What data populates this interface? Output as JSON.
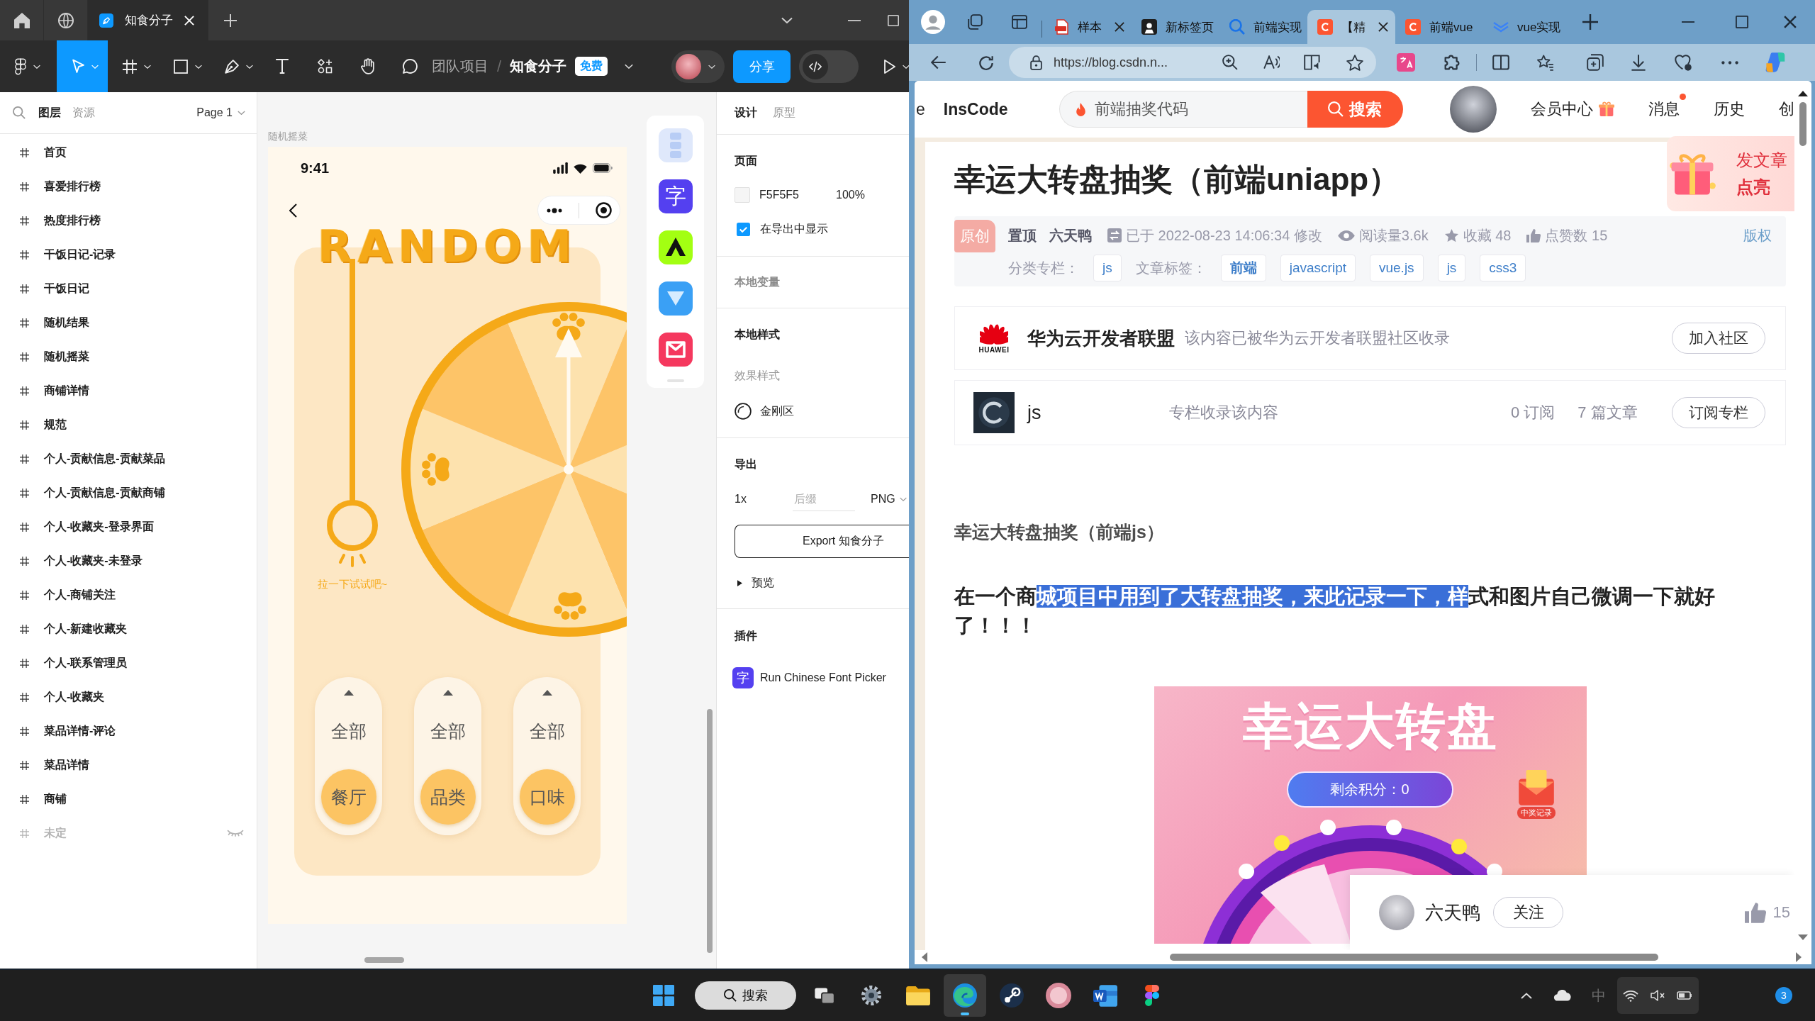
{
  "figma": {
    "tabs": [
      {
        "kind": "home",
        "selected": false
      },
      {
        "kind": "globe",
        "selected": false
      },
      {
        "kind": "file",
        "label": "知食分子",
        "selected": true
      }
    ],
    "tools": [
      {
        "kind": "main-menu",
        "selected": false
      },
      {
        "kind": "move",
        "selected": true
      },
      {
        "kind": "frame",
        "selected": false
      },
      {
        "kind": "shape",
        "selected": false
      },
      {
        "kind": "pen",
        "selected": false
      },
      {
        "kind": "text",
        "selected": false
      },
      {
        "kind": "resources",
        "selected": false
      },
      {
        "kind": "hand",
        "selected": false
      },
      {
        "kind": "comment",
        "selected": false
      }
    ],
    "breadcrumb": {
      "team": "团队项目",
      "separator": "/",
      "file": "知食分子",
      "plan": "免费"
    },
    "share_button": "分享",
    "dev_mode": {
      "on": false
    },
    "layers_panel": {
      "tabs": [
        {
          "label": "图层",
          "selected": true
        },
        {
          "label": "资源",
          "selected": false
        }
      ],
      "page": "Page 1",
      "layers": [
        {
          "name": "首页",
          "hidden": false
        },
        {
          "name": "喜爱排行榜",
          "hidden": false
        },
        {
          "name": "热度排行榜",
          "hidden": false
        },
        {
          "name": "干饭日记-记录",
          "hidden": false
        },
        {
          "name": "干饭日记",
          "hidden": false
        },
        {
          "name": "随机结果",
          "hidden": false
        },
        {
          "name": "随机摇菜",
          "hidden": false
        },
        {
          "name": "商铺详情",
          "hidden": false
        },
        {
          "name": "规范",
          "hidden": false
        },
        {
          "name": "个人-贡献信息-贡献菜品",
          "hidden": false
        },
        {
          "name": "个人-贡献信息-贡献商铺",
          "hidden": false
        },
        {
          "name": "个人-收藏夹-登录界面",
          "hidden": false
        },
        {
          "name": "个人-收藏夹-未登录",
          "hidden": false
        },
        {
          "name": "个人-商铺关注",
          "hidden": false
        },
        {
          "name": "个人-新建收藏夹",
          "hidden": false
        },
        {
          "name": "个人-联系管理员",
          "hidden": false
        },
        {
          "name": "个人-收藏夹",
          "hidden": false
        },
        {
          "name": "菜品详情-评论",
          "hidden": false
        },
        {
          "name": "菜品详情",
          "hidden": false
        },
        {
          "name": "商铺",
          "hidden": false
        },
        {
          "name": "未定",
          "hidden": true
        }
      ]
    },
    "canvas": {
      "frame_label": "随机摇菜",
      "phone": {
        "time": "9:41",
        "title": "RANDOM",
        "hint": "拉一下试试吧~",
        "selectors": [
          {
            "value": "全部",
            "label": "餐厅"
          },
          {
            "value": "全部",
            "label": "品类"
          },
          {
            "value": "全部",
            "label": "口味"
          }
        ]
      },
      "plugin_dock": [
        {
          "kind": "layout"
        },
        {
          "kind": "font",
          "glyph": "字"
        },
        {
          "kind": "triangle"
        },
        {
          "kind": "v-tile"
        },
        {
          "kind": "mail"
        }
      ]
    },
    "design_panel": {
      "tabs": [
        {
          "label": "设计",
          "selected": true
        },
        {
          "label": "原型",
          "selected": false
        }
      ],
      "page_section": {
        "title": "页面",
        "color": "F5F5F5",
        "opacity": "100%",
        "export_toggle": {
          "label": "在导出中显示",
          "checked": true
        }
      },
      "variables_section": {
        "title": "本地变量"
      },
      "styles_section": {
        "title": "本地样式",
        "group": "效果样式",
        "styles": [
          {
            "name": "金刚区"
          }
        ]
      },
      "export_section": {
        "title": "导出",
        "scale": "1x",
        "suffix_placeholder": "后缀",
        "format": "PNG",
        "button": "Export 知食分子",
        "preview": "预览"
      },
      "plugins_section": {
        "title": "插件",
        "plugins": [
          {
            "glyph": "字",
            "name": "Run Chinese Font Picker"
          }
        ]
      }
    }
  },
  "browser": {
    "tabs": [
      {
        "kind": "pdf",
        "title": "样本",
        "selected": false,
        "closable": true
      },
      {
        "kind": "app",
        "title": "新标签页",
        "selected": false,
        "closable": false
      },
      {
        "kind": "search",
        "title": "前端实现",
        "selected": false,
        "closable": false
      },
      {
        "kind": "csdn",
        "title": "【精",
        "selected": true,
        "closable": true
      },
      {
        "kind": "csdn",
        "title": "前端vue",
        "selected": false,
        "closable": false
      },
      {
        "kind": "vue",
        "title": "vue实现",
        "selected": false,
        "closable": false
      }
    ],
    "url": "https://blog.csdn.n...",
    "site_header": {
      "cut_nav": "e",
      "brand": "InsCode",
      "search_value": "前端抽奖代码",
      "search_button": "搜索",
      "nav": [
        {
          "label": "会员中心",
          "kind": "gift"
        },
        {
          "label": "消息",
          "kind": "dot"
        },
        {
          "label": "历史",
          "kind": "plain"
        },
        {
          "label": "创",
          "kind": "plain"
        }
      ]
    },
    "promo": {
      "line1": "发文章",
      "line2": "点亮"
    },
    "article": {
      "title": "幸运大转盘抽奖（前端uniapp）",
      "badge": "原创",
      "pinned": "置顶",
      "author": "六天鸭",
      "modified": "已于 2022-08-23 14:06:34 修改",
      "reads": "阅读量3.6k",
      "favorites": "收藏 48",
      "likes": "点赞数 15",
      "copyright": "版权",
      "column_label": "分类专栏：",
      "columns": [
        "js"
      ],
      "tags_label": "文章标签：",
      "tags": [
        "前端",
        "javascript",
        "vue.js",
        "js",
        "css3"
      ]
    },
    "community_card": {
      "logo_text": "HUAWEI",
      "name": "华为云开发者联盟",
      "note": "该内容已被华为云开发者联盟社区收录",
      "button": "加入社区"
    },
    "column_card": {
      "name": "js",
      "note": "专栏收录该内容",
      "subscribers": "0 订阅",
      "articles": "7 篇文章",
      "button": "订阅专栏"
    },
    "content": {
      "heading": "幸运大转盘抽奖（前端js）",
      "paragraph": [
        {
          "text": "在一个商",
          "highlighted": false
        },
        {
          "text": "城项目中用到了大转盘抽奖，来此记录一下，样",
          "highlighted": true
        },
        {
          "text": "式和图片自己微调一下就好了！！！",
          "highlighted": false
        }
      ],
      "image": {
        "title": "幸运大转盘",
        "points": "剩余积分：0",
        "records": "中奖记录"
      }
    },
    "author_bar": {
      "name": "六天鸭",
      "follow": "关注",
      "likes": "15"
    }
  },
  "taskbar": {
    "search": "搜索",
    "apps": [
      {
        "kind": "task-view",
        "active": false
      },
      {
        "kind": "settings",
        "active": false
      },
      {
        "kind": "explorer",
        "active": false
      },
      {
        "kind": "edge",
        "active": true
      },
      {
        "kind": "steam",
        "active": false
      },
      {
        "kind": "avatar-app",
        "active": false
      },
      {
        "kind": "word",
        "active": false
      },
      {
        "kind": "figma",
        "active": false
      }
    ],
    "input_indicator": "中",
    "notifications": "3"
  }
}
